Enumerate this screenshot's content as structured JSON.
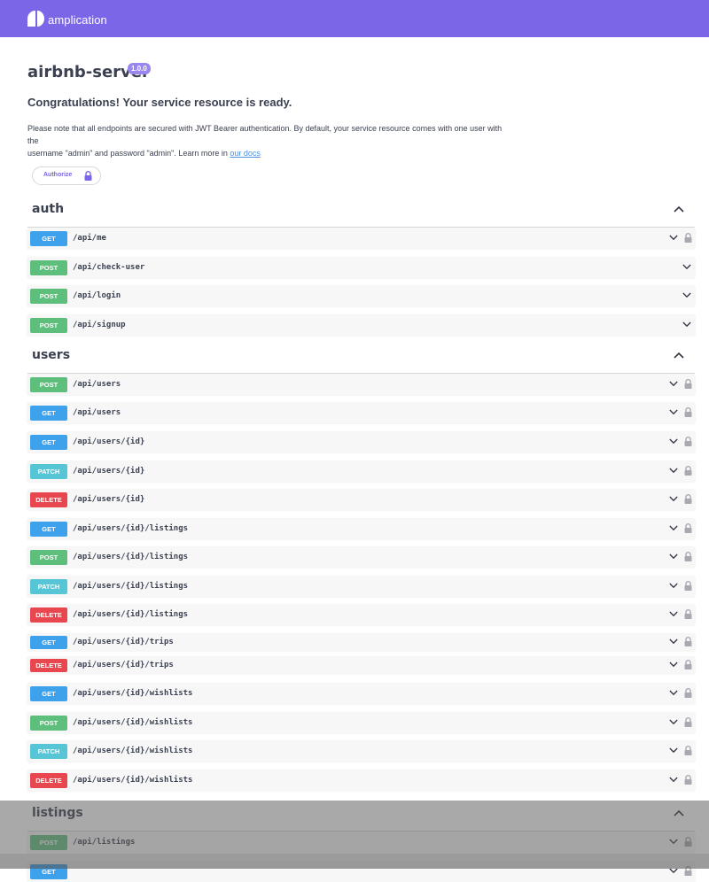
{
  "header": {
    "brand": "amplication"
  },
  "info": {
    "title": "airbnb-server",
    "version": "1.0.0",
    "subtitle": "Congratulations! Your service resource is ready.",
    "desc_line1": "Please note that all endpoints are secured with JWT Bearer authentication. By default, your service resource comes with one user with the",
    "desc_line2": "username \"admin\" and password \"admin\". Learn more in ",
    "docs_link": "our docs"
  },
  "authorize": {
    "label": "Authorize"
  },
  "colors": {
    "GET": "#3da1ec",
    "POST": "#5ebf7c",
    "PATCH": "#56c6d6",
    "DELETE": "#e8474f",
    "accent": "#7c66e8"
  },
  "sections": [
    {
      "name": "auth",
      "ops": [
        {
          "method": "GET",
          "path": "/api/me",
          "locked": true
        },
        {
          "method": "POST",
          "path": "/api/check-user",
          "locked": false
        },
        {
          "method": "POST",
          "path": "/api/login",
          "locked": false
        },
        {
          "method": "POST",
          "path": "/api/signup",
          "locked": false
        }
      ]
    },
    {
      "name": "users",
      "ops": [
        {
          "method": "POST",
          "path": "/api/users",
          "locked": true
        },
        {
          "method": "GET",
          "path": "/api/users",
          "locked": true
        },
        {
          "method": "GET",
          "path": "/api/users/{id}",
          "locked": true
        },
        {
          "method": "PATCH",
          "path": "/api/users/{id}",
          "locked": true
        },
        {
          "method": "DELETE",
          "path": "/api/users/{id}",
          "locked": true
        },
        {
          "method": "GET",
          "path": "/api/users/{id}/listings",
          "locked": true
        },
        {
          "method": "POST",
          "path": "/api/users/{id}/listings",
          "locked": true
        },
        {
          "method": "PATCH",
          "path": "/api/users/{id}/listings",
          "locked": true
        },
        {
          "method": "DELETE",
          "path": "/api/users/{id}/listings",
          "locked": true
        },
        {
          "method": "GET",
          "path": "/api/users/{id}/trips",
          "locked": true
        },
        {
          "method": "DELETE",
          "path": "/api/users/{id}/trips",
          "locked": true
        },
        {
          "method": "GET",
          "path": "/api/users/{id}/wishlists",
          "locked": true
        },
        {
          "method": "POST",
          "path": "/api/users/{id}/wishlists",
          "locked": true
        },
        {
          "method": "PATCH",
          "path": "/api/users/{id}/wishlists",
          "locked": true
        },
        {
          "method": "DELETE",
          "path": "/api/users/{id}/wishlists",
          "locked": true
        }
      ]
    },
    {
      "name": "listings",
      "ops": [
        {
          "method": "POST",
          "path": "/api/listings",
          "locked": true
        },
        {
          "method": "GET",
          "path": "",
          "locked": true
        }
      ]
    }
  ],
  "icons": {
    "logo": "amplication-logo-icon",
    "lock": "lock-icon",
    "expand": "chevron-down-icon",
    "collapse": "chevron-up-icon"
  }
}
